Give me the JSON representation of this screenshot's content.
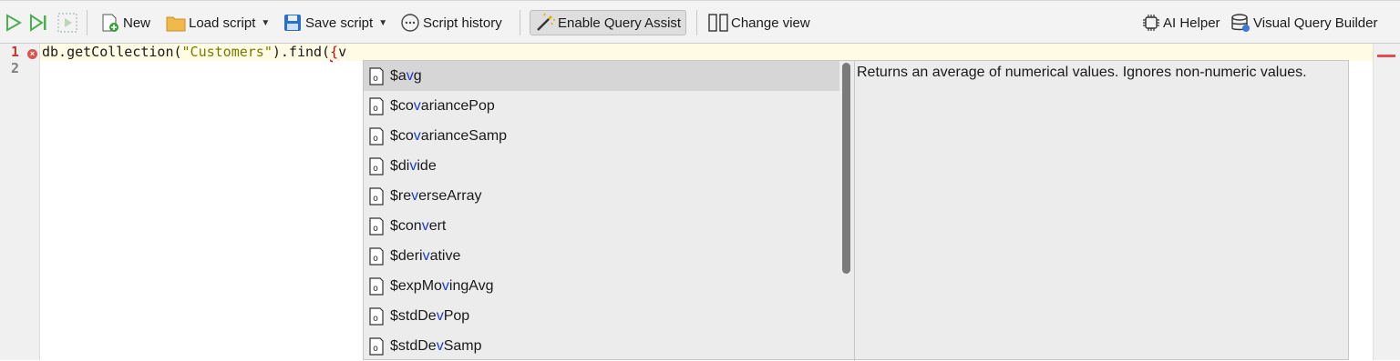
{
  "toolbar": {
    "new_label": "New",
    "load_label": "Load script",
    "save_label": "Save script",
    "history_label": "Script history",
    "query_assist_label": "Enable Query Assist",
    "change_view_label": "Change view",
    "ai_helper_label": "AI Helper",
    "visual_query_label": "Visual Query Builder"
  },
  "editor": {
    "line_numbers": [
      "1",
      "2"
    ],
    "code_prefix": "db.getCollection(",
    "code_string": "\"Customers\"",
    "code_mid": ").find(",
    "code_brace": "{",
    "code_suffix": "v"
  },
  "autocomplete": {
    "items": [
      {
        "pre": "$a",
        "hl": "v",
        "post": "g"
      },
      {
        "pre": "$co",
        "hl": "v",
        "post": "ariancePop"
      },
      {
        "pre": "$co",
        "hl": "v",
        "post": "arianceSamp"
      },
      {
        "pre": "$di",
        "hl": "v",
        "post": "ide"
      },
      {
        "pre": "$re",
        "hl": "v",
        "post": "erseArray"
      },
      {
        "pre": "$con",
        "hl": "v",
        "post": "ert"
      },
      {
        "pre": "$deri",
        "hl": "v",
        "post": "ative"
      },
      {
        "pre": "$expMo",
        "hl": "v",
        "post": "ingAvg"
      },
      {
        "pre": "$stdDe",
        "hl": "v",
        "post": "Pop"
      },
      {
        "pre": "$stdDe",
        "hl": "v",
        "post": "Samp"
      }
    ],
    "selected_index": 0,
    "description": "Returns an average of numerical values. Ignores non-numeric values."
  }
}
